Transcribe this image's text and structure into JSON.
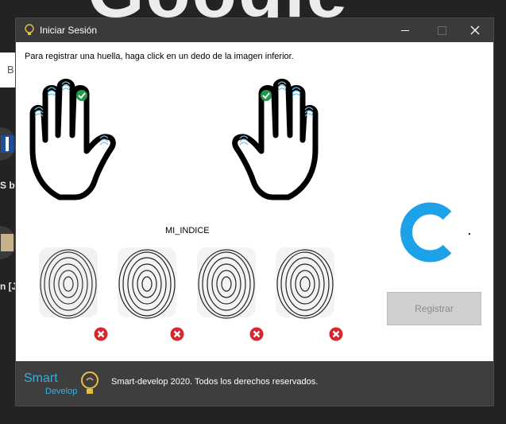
{
  "background": {
    "header_text": "Google",
    "search_partial": "B",
    "item1_partial": "S by",
    "item2_partial": "n [J"
  },
  "window": {
    "title": "Iniciar Sesión",
    "controls": {
      "minimize": "minimize-icon",
      "maximize": "maximize-icon",
      "close": "close-icon"
    }
  },
  "instruction": "Para registrar una huella, haga click en un dedo de la imagen inferior.",
  "hands": [
    {
      "side": "left",
      "checked_finger": "index"
    },
    {
      "side": "right",
      "checked_finger": "index"
    }
  ],
  "selected_finger_label": "MI_INDICE",
  "fingerprint_samples": [
    {
      "status": "error"
    },
    {
      "status": "error"
    },
    {
      "status": "error"
    },
    {
      "status": "error"
    }
  ],
  "register_button": "Registrar",
  "footer": {
    "logo_line1": "Smart",
    "logo_line2": "Develop",
    "copyright": "Smart-develop 2020. Todos los derechos reservados."
  },
  "colors": {
    "titlebar": "#3a3a3a",
    "footer": "#3e3e3e",
    "accent_blue": "#1da1e8",
    "check_green": "#1e9a4a",
    "error_red": "#d9262c",
    "button_disabled": "#d0d0d0"
  }
}
